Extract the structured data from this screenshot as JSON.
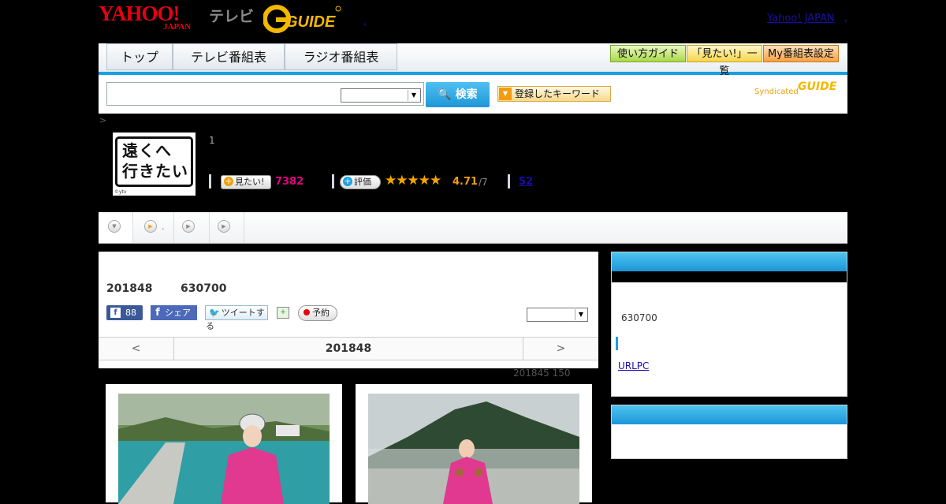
{
  "header": {
    "logo_yahoo": "YAHOO!",
    "logo_japan": "JAPAN",
    "logo_tv": "テレビ",
    "logo_gguide": "G GUIDE",
    "top_link": "Yahoo! JAPAN",
    "dot": ",",
    "dot2": ","
  },
  "nav": {
    "tabs": [
      "トップ",
      "テレビ番組表",
      "ラジオ番組表"
    ],
    "guide_buttons": [
      "使い方ガイド",
      "「見たい!」一覧",
      "My番組表設定"
    ]
  },
  "search": {
    "button_label": "検索",
    "keyword_button": "登録したキーワード",
    "syndicated": "Syndicated",
    "syndicated_logo": "GUIDE"
  },
  "breadcrumb": ">",
  "program": {
    "thumb_title": "遠くへ\n行きたい",
    "thumb_copyright": "©ytv",
    "episode_number": "1",
    "watch_label": "見たい!",
    "watch_count": "7382",
    "rate_label": "評価",
    "stars": "★★★★★",
    "rating": "4.71",
    "rating_total": "/7",
    "review_count": "52"
  },
  "tabs_strip": {
    "dot_label": "."
  },
  "main": {
    "air_date": "201848",
    "air_time": "630700",
    "fb_like_count": "88",
    "fb_share_label": "シェア",
    "tweet_label": "ツイートする",
    "reserve_label": "予約",
    "pager": {
      "prev": "<",
      "current": "201848",
      "next": ">"
    },
    "photo_meta": "201845  150"
  },
  "sidebar": {
    "time": "630700",
    "link": "URLPC"
  },
  "colors": {
    "accent_blue": "#1aa0e0",
    "yahoo_red": "#e60012",
    "watch_pink": "#e5007f",
    "star_orange": "#f6a500"
  }
}
